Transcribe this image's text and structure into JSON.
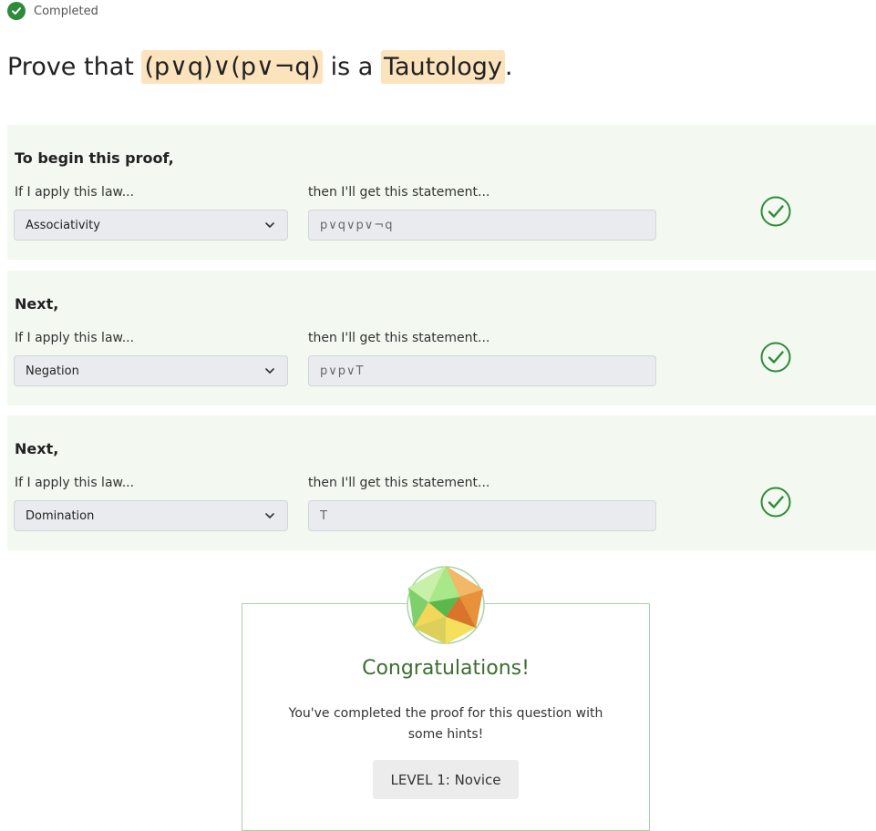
{
  "status": {
    "label": "Completed",
    "icon": "check-circle-icon",
    "color": "#2e8b3a"
  },
  "question": {
    "prefix": "Prove that",
    "expression": "(p∨q)∨(p∨¬q)",
    "middle": "is a",
    "target": "Tautology",
    "suffix": ".",
    "highlight_color": "#fbe3bd"
  },
  "steps": [
    {
      "heading": "To begin this proof,",
      "law_label": "If I apply this law...",
      "statement_label": "then I'll get this statement...",
      "law_value": "Associativity",
      "statement_value": "p∨q∨p∨¬q",
      "result_icon": "check-circle-outline-icon"
    },
    {
      "heading": "Next,",
      "law_label": "If I apply this law...",
      "statement_label": "then I'll get this statement...",
      "law_value": "Negation",
      "statement_value": "p∨p∨T",
      "result_icon": "check-circle-outline-icon"
    },
    {
      "heading": "Next,",
      "law_label": "If I apply this law...",
      "statement_label": "then I'll get this statement...",
      "law_value": "Domination",
      "statement_value": "T",
      "result_icon": "check-circle-outline-icon"
    }
  ],
  "congrats": {
    "title": "Congratulations!",
    "message": "You've completed the proof for this question with some hints!",
    "level_button": "LEVEL 1: Novice",
    "badge_icon": "polyhedron-badge-icon"
  },
  "colors": {
    "step_bg": "#f3f8f0",
    "success_green": "#2e8b3a",
    "congrats_text": "#3c6e2f"
  }
}
